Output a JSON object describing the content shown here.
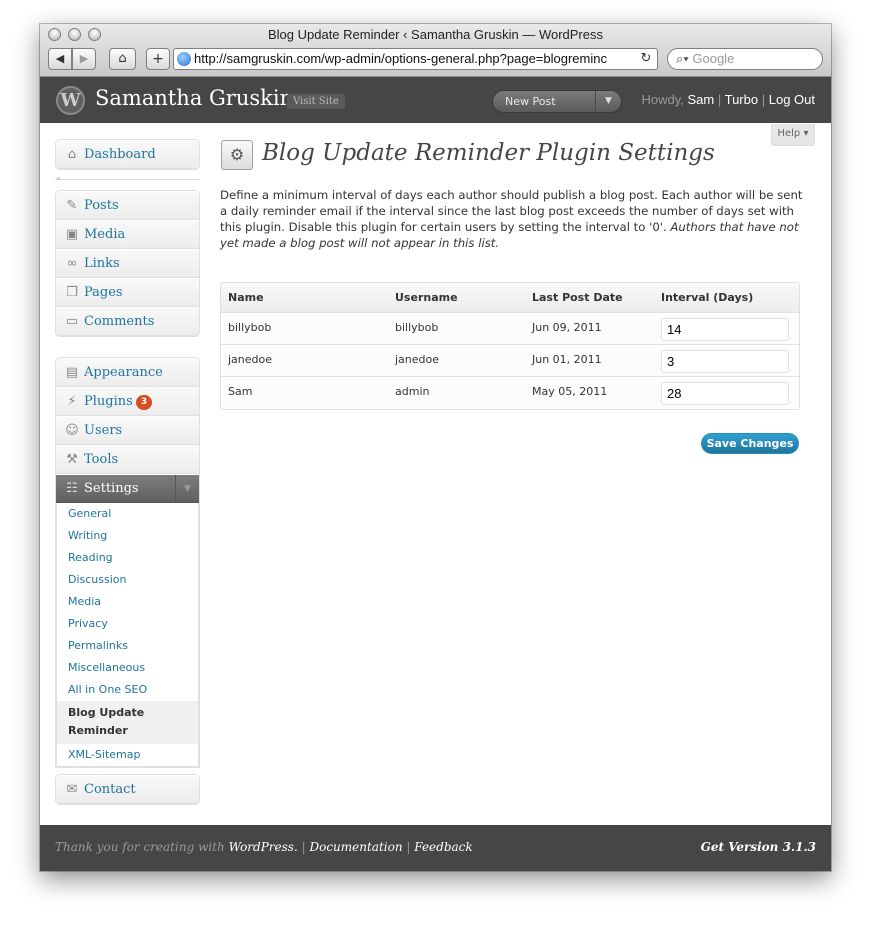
{
  "window": {
    "title": "Blog Update Reminder ‹ Samantha Gruskin — WordPress",
    "url": "http://samgruskin.com/wp-admin/options-general.php?page=blogreminc",
    "search_placeholder": "Google"
  },
  "header": {
    "site_title": "Samantha Gruskin",
    "visit_site": "Visit Site",
    "new_post": "New Post",
    "howdy": "Howdy,",
    "user": "Sam",
    "sep1": "|",
    "turbo": "Turbo",
    "sep2": "|",
    "logout": "Log Out"
  },
  "help": "Help",
  "sidebar": {
    "dashboard": "Dashboard",
    "posts": "Posts",
    "media": "Media",
    "links": "Links",
    "pages": "Pages",
    "comments": "Comments",
    "appearance": "Appearance",
    "plugins": "Plugins",
    "plugins_badge": "3",
    "users": "Users",
    "tools": "Tools",
    "settings": "Settings",
    "settings_sub": [
      "General",
      "Writing",
      "Reading",
      "Discussion",
      "Media",
      "Privacy",
      "Permalinks",
      "Miscellaneous",
      "All in One SEO",
      "Blog Update Reminder",
      "XML-Sitemap"
    ],
    "contact": "Contact"
  },
  "main": {
    "title": "Blog Update Reminder Plugin Settings",
    "description": "Define a minimum interval of days each author should publish a blog post. Each author will be sent a daily reminder email if the interval since the last blog post exceeds the number of days set with this plugin. Disable this plugin for certain users by setting the interval to '0'.",
    "description_italic": "Authors that have not yet made a blog post will not appear in this list.",
    "columns": [
      "Name",
      "Username",
      "Last Post Date",
      "Interval (Days)"
    ],
    "rows": [
      {
        "name": "billybob",
        "username": "billybob",
        "last_post": "Jun 09, 2011",
        "interval": "14"
      },
      {
        "name": "janedoe",
        "username": "janedoe",
        "last_post": "Jun 01, 2011",
        "interval": "3"
      },
      {
        "name": "Sam",
        "username": "admin",
        "last_post": "May 05, 2011",
        "interval": "28"
      }
    ],
    "save_label": "Save Changes"
  },
  "footer": {
    "thanks": "Thank you for creating with",
    "wordpress": "WordPress.",
    "sep1": "|",
    "documentation": "Documentation",
    "sep2": "|",
    "feedback": "Feedback",
    "version": "Get Version 3.1.3"
  }
}
